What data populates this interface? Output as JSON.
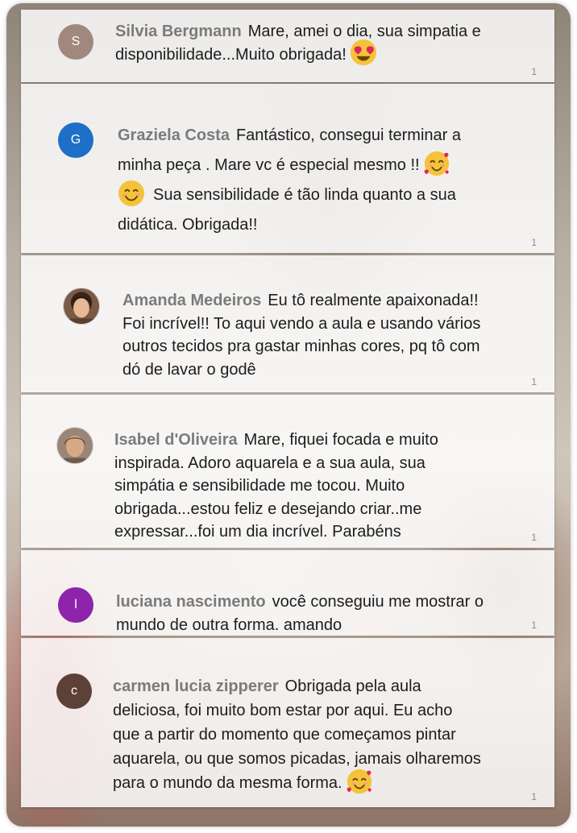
{
  "comments": [
    {
      "author": "Silvia Bergmann",
      "avatar": {
        "type": "initial",
        "initial": "S",
        "color": "#a1887f"
      },
      "lines": [
        "Mare, amei o dia, sua simpatia e",
        "disponibilidade...Muito obrigada!"
      ],
      "likes": "1"
    },
    {
      "author": "Graziela Costa",
      "avatar": {
        "type": "initial",
        "initial": "G",
        "color": "#1e6fc8"
      },
      "lines": [
        "Fantástico, consegui terminar a",
        "minha peça . Mare vc é especial mesmo !!",
        "Sua sensibilidade é tão linda quanto a sua",
        "didática. Obrigada!!"
      ],
      "likes": "1"
    },
    {
      "author": "Amanda Medeiros",
      "avatar": {
        "type": "photo"
      },
      "lines": [
        "Eu tô realmente apaixonada!!",
        "Foi incrível!! To aqui vendo a aula e usando vários",
        "outros tecidos pra gastar minhas cores, pq tô com",
        "dó de lavar o godê"
      ],
      "likes": "1"
    },
    {
      "author": "Isabel d'Oliveira",
      "avatar": {
        "type": "photo"
      },
      "lines": [
        "Mare, fiquei focada e muito",
        "inspirada. Adoro aquarela e a sua aula, sua",
        "simpátia e sensibilidade me tocou. Muito",
        "obrigada...estou feliz e desejando criar..me",
        "expressar...foi um dia incrível. Parabéns"
      ],
      "likes": "1"
    },
    {
      "author": "luciana nascimento",
      "avatar": {
        "type": "initial",
        "initial": "l",
        "color": "#8e24aa"
      },
      "lines": [
        "você conseguiu me mostrar o",
        "mundo de outra forma. amando"
      ],
      "likes": "1"
    },
    {
      "author": "carmen lucia zipperer",
      "avatar": {
        "type": "initial",
        "initial": "c",
        "color": "#5d4037"
      },
      "lines": [
        "Obrigada pela aula",
        "deliciosa, foi muito bom estar por aqui. Eu acho",
        "que a partir do momento que começamos pintar",
        "aquarela, ou que somos picadas, jamais olharemos",
        "para o mundo da mesma forma."
      ],
      "likes": "1"
    }
  ]
}
